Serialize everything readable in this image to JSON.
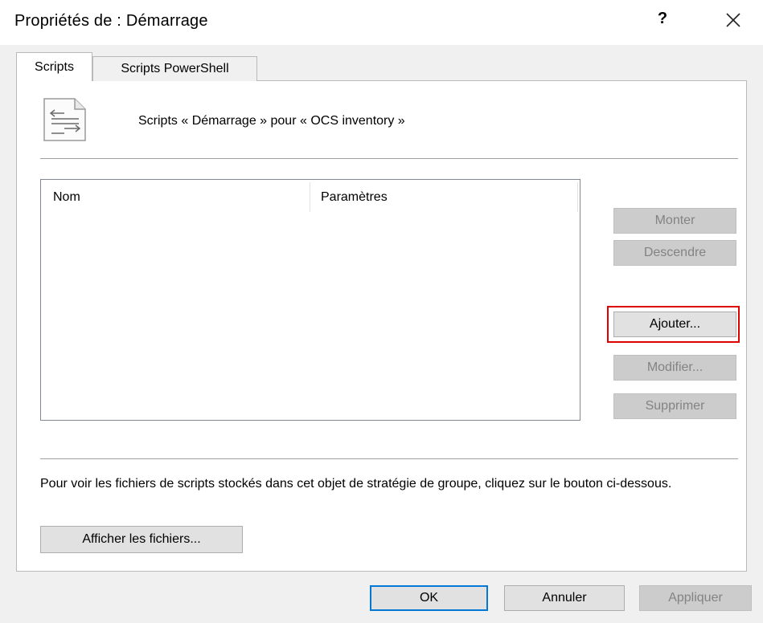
{
  "window": {
    "title": "Propriétés de : Démarrage",
    "help_label": "?",
    "close_icon": "close-icon"
  },
  "tabs": [
    {
      "label": "Scripts",
      "active": true
    },
    {
      "label": "Scripts PowerShell",
      "active": false
    }
  ],
  "header": {
    "icon": "script-file-icon",
    "text": "Scripts « Démarrage » pour « OCS inventory »"
  },
  "list": {
    "columns": [
      "Nom",
      "Paramètres"
    ],
    "rows": []
  },
  "side_buttons": {
    "up": "Monter",
    "down": "Descendre",
    "add": "Ajouter...",
    "edit": "Modifier...",
    "delete": "Supprimer"
  },
  "info": {
    "text": "Pour voir les fichiers de scripts stockés dans cet objet de stratégie de groupe, cliquez sur le bouton ci-dessous.",
    "show_files_label": "Afficher les fichiers..."
  },
  "footer": {
    "ok": "OK",
    "cancel": "Annuler",
    "apply": "Appliquer"
  },
  "colors": {
    "highlight": "#e00000",
    "default_button_border": "#0078d7"
  }
}
